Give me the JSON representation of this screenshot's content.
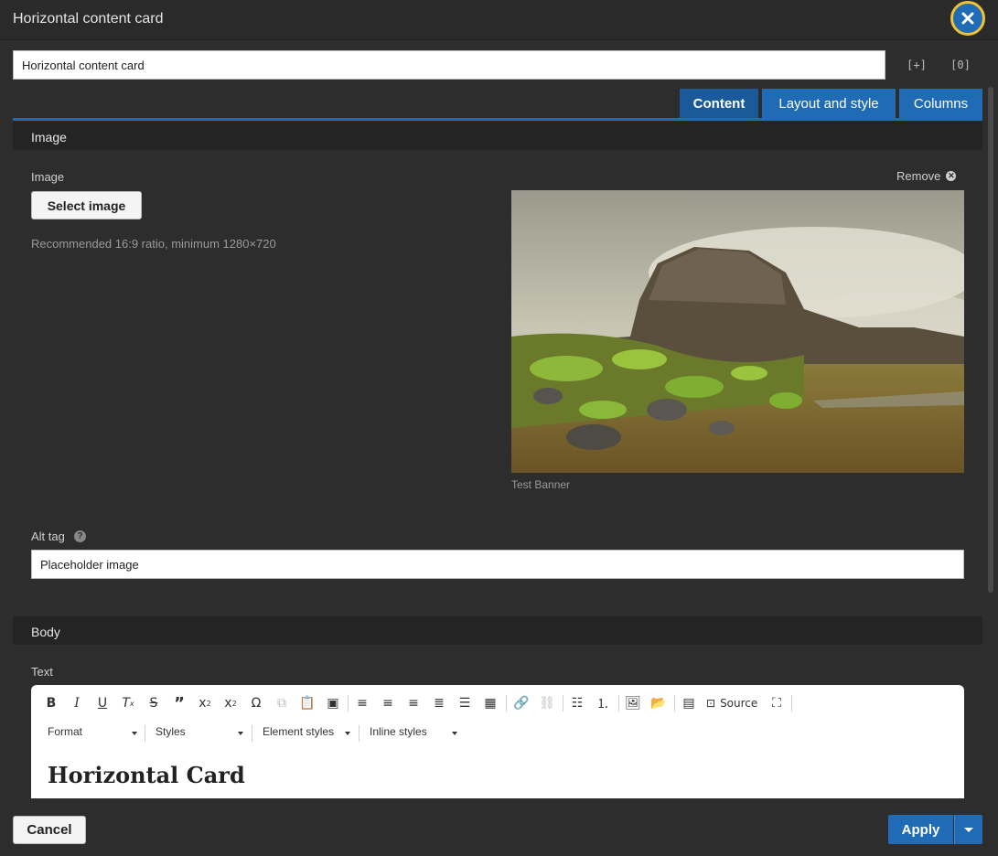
{
  "dialog": {
    "title": "Horizontal content card"
  },
  "name_field": {
    "value": "Horizontal content card"
  },
  "header_icons": {
    "expand": "[+]",
    "collapse": "[0]"
  },
  "tabs": [
    {
      "label": "Content",
      "active": true
    },
    {
      "label": "Layout and style",
      "active": false
    },
    {
      "label": "Columns",
      "active": false
    }
  ],
  "image_section": {
    "heading": "Image",
    "field_label": "Image",
    "select_button": "Select image",
    "hint": "Recommended 16:9 ratio, minimum 1280×720",
    "remove_label": "Remove",
    "caption": "Test Banner",
    "alt_label": "Alt tag",
    "alt_value": "Placeholder image"
  },
  "body_section": {
    "heading": "Body",
    "field_label": "Text",
    "toolbar": {
      "source_label": "Source",
      "format": "Format",
      "styles": "Styles",
      "element_styles": "Element styles",
      "inline_styles": "Inline styles"
    },
    "content_heading": "Horizontal Card"
  },
  "footer": {
    "cancel": "Cancel",
    "apply": "Apply"
  },
  "colors": {
    "accent": "#1f6bb5",
    "focus_ring": "#f1c232",
    "background": "#2d2d2d"
  }
}
